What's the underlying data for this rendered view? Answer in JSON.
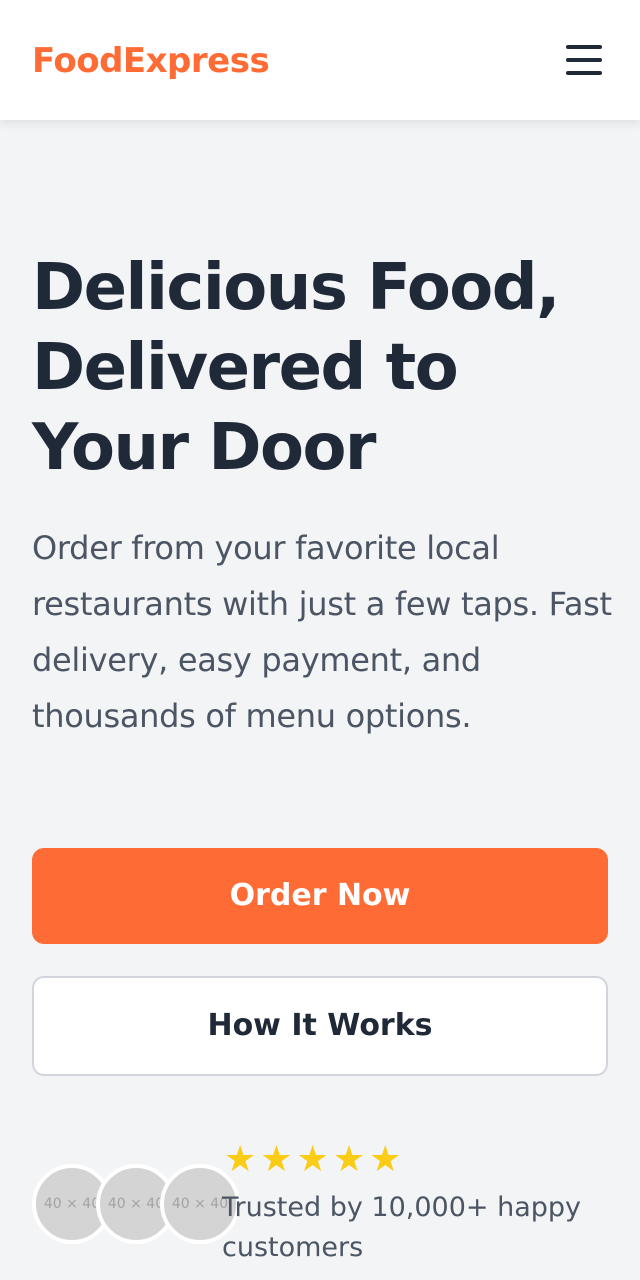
{
  "header": {
    "logo": "FoodExpress",
    "menu_icon": "hamburger-menu-icon"
  },
  "hero": {
    "headline": "Delicious Food, Delivered to Your Door",
    "subtext": "Order from your favorite local restaurants with just a few taps. Fast delivery, easy payment, and thousands of menu options.",
    "primary_button": "Order Now",
    "secondary_button": "How It Works"
  },
  "social_proof": {
    "avatars": [
      "40 × 40",
      "40 × 40",
      "40 × 40"
    ],
    "stars": "★★★★★",
    "rating": 5,
    "trust_text": "Trusted by 10,000+ happy customers"
  },
  "colors": {
    "brand": "#ff6b35",
    "heading": "#1f2937",
    "body_text": "#4b5563",
    "star": "#facc15",
    "background": "#f3f4f6"
  }
}
